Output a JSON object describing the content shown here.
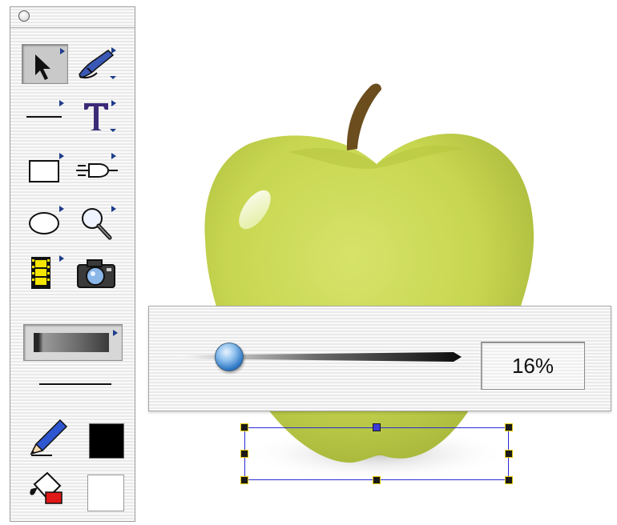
{
  "opacity": {
    "value_text": "16%",
    "fraction": 0.16
  },
  "palette": {
    "tools": [
      {
        "name": "arrow-tool",
        "icon": "arrow-pointer-icon",
        "selected": true
      },
      {
        "name": "pen-tool",
        "icon": "pen-icon"
      },
      {
        "name": "line-tool",
        "icon": "line-icon"
      },
      {
        "name": "text-tool",
        "icon": "text-t-icon"
      },
      {
        "name": "rectangle-tool",
        "icon": "rectangle-icon"
      },
      {
        "name": "connector-tool",
        "icon": "connector-icon"
      },
      {
        "name": "oval-tool",
        "icon": "oval-icon"
      },
      {
        "name": "zoom-tool",
        "icon": "magnifier-icon"
      },
      {
        "name": "movie-tool",
        "icon": "film-strip-icon"
      },
      {
        "name": "camera-tool",
        "icon": "camera-icon"
      }
    ],
    "stroke_color": "#000000",
    "fill_color": "#ffffff"
  },
  "colors": {
    "apple": "#c9d84f",
    "selection": "#2a2ad6",
    "slider_thumb": "#2f78c4"
  }
}
